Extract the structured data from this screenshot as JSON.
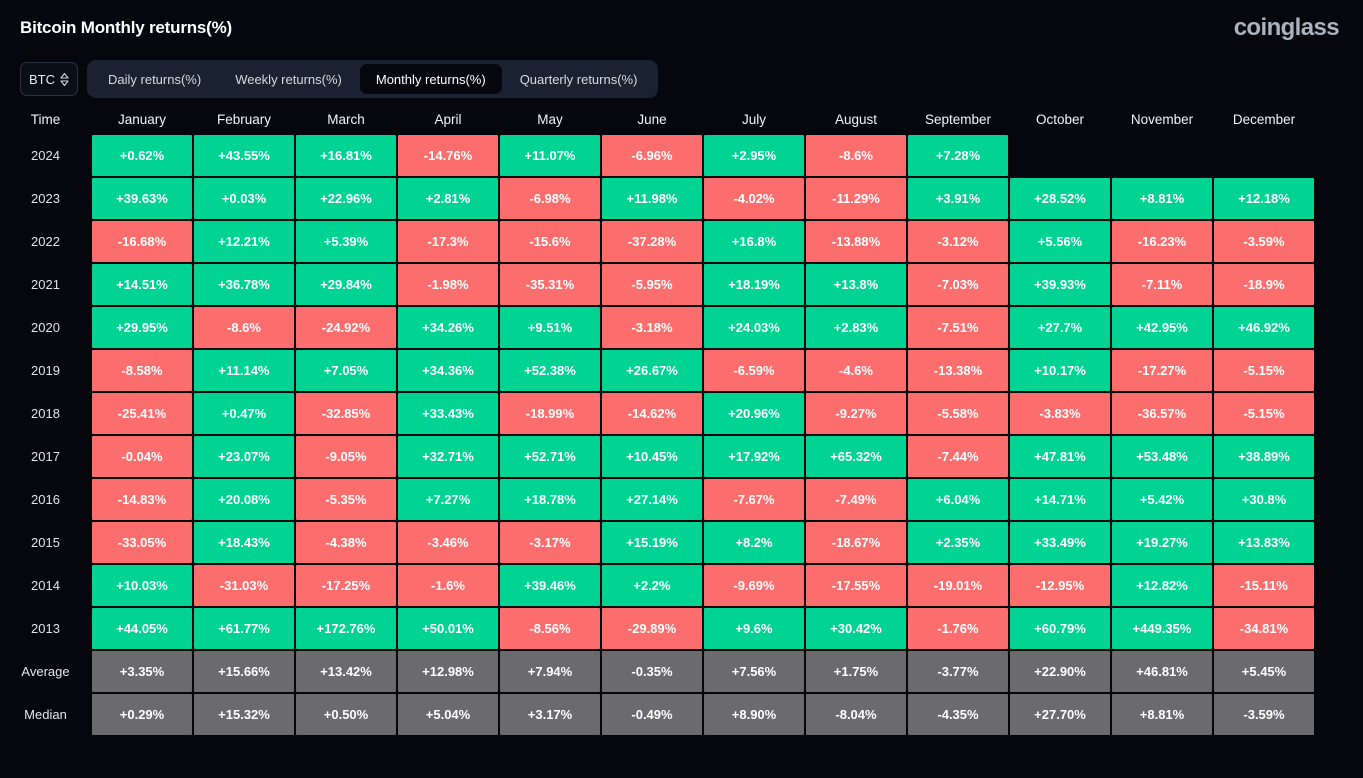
{
  "header": {
    "title": "Bitcoin Monthly returns(%)",
    "brand": "coinglass"
  },
  "toolbar": {
    "coin_selected": "BTC",
    "coin_icon": "chevron-up-down-icon",
    "tabs": [
      {
        "label": "Daily returns(%)",
        "active": false
      },
      {
        "label": "Weekly returns(%)",
        "active": false
      },
      {
        "label": "Monthly returns(%)",
        "active": true
      },
      {
        "label": "Quarterly returns(%)",
        "active": false
      }
    ]
  },
  "colors": {
    "positive": "#00d392",
    "negative": "#fc6e6e",
    "neutral": "#6b6b6e",
    "background": "#05070d",
    "tab_bar": "#1a2130",
    "brand_text": "#aab2bd"
  },
  "chart_data": {
    "type": "heatmap",
    "title": "Bitcoin Monthly returns(%)",
    "xlabel": "",
    "ylabel": "Time",
    "columns": [
      "Time",
      "January",
      "February",
      "March",
      "April",
      "May",
      "June",
      "July",
      "August",
      "September",
      "October",
      "November",
      "December"
    ],
    "rows": [
      {
        "label": "2024",
        "kind": "year",
        "values": [
          "+0.62%",
          "+43.55%",
          "+16.81%",
          "-14.76%",
          "+11.07%",
          "-6.96%",
          "+2.95%",
          "-8.6%",
          "+7.28%",
          "",
          "",
          ""
        ]
      },
      {
        "label": "2023",
        "kind": "year",
        "values": [
          "+39.63%",
          "+0.03%",
          "+22.96%",
          "+2.81%",
          "-6.98%",
          "+11.98%",
          "-4.02%",
          "-11.29%",
          "+3.91%",
          "+28.52%",
          "+8.81%",
          "+12.18%"
        ]
      },
      {
        "label": "2022",
        "kind": "year",
        "values": [
          "-16.68%",
          "+12.21%",
          "+5.39%",
          "-17.3%",
          "-15.6%",
          "-37.28%",
          "+16.8%",
          "-13.88%",
          "-3.12%",
          "+5.56%",
          "-16.23%",
          "-3.59%"
        ]
      },
      {
        "label": "2021",
        "kind": "year",
        "values": [
          "+14.51%",
          "+36.78%",
          "+29.84%",
          "-1.98%",
          "-35.31%",
          "-5.95%",
          "+18.19%",
          "+13.8%",
          "-7.03%",
          "+39.93%",
          "-7.11%",
          "-18.9%"
        ]
      },
      {
        "label": "2020",
        "kind": "year",
        "values": [
          "+29.95%",
          "-8.6%",
          "-24.92%",
          "+34.26%",
          "+9.51%",
          "-3.18%",
          "+24.03%",
          "+2.83%",
          "-7.51%",
          "+27.7%",
          "+42.95%",
          "+46.92%"
        ]
      },
      {
        "label": "2019",
        "kind": "year",
        "values": [
          "-8.58%",
          "+11.14%",
          "+7.05%",
          "+34.36%",
          "+52.38%",
          "+26.67%",
          "-6.59%",
          "-4.6%",
          "-13.38%",
          "+10.17%",
          "-17.27%",
          "-5.15%"
        ]
      },
      {
        "label": "2018",
        "kind": "year",
        "values": [
          "-25.41%",
          "+0.47%",
          "-32.85%",
          "+33.43%",
          "-18.99%",
          "-14.62%",
          "+20.96%",
          "-9.27%",
          "-5.58%",
          "-3.83%",
          "-36.57%",
          "-5.15%"
        ]
      },
      {
        "label": "2017",
        "kind": "year",
        "values": [
          "-0.04%",
          "+23.07%",
          "-9.05%",
          "+32.71%",
          "+52.71%",
          "+10.45%",
          "+17.92%",
          "+65.32%",
          "-7.44%",
          "+47.81%",
          "+53.48%",
          "+38.89%"
        ]
      },
      {
        "label": "2016",
        "kind": "year",
        "values": [
          "-14.83%",
          "+20.08%",
          "-5.35%",
          "+7.27%",
          "+18.78%",
          "+27.14%",
          "-7.67%",
          "-7.49%",
          "+6.04%",
          "+14.71%",
          "+5.42%",
          "+30.8%"
        ]
      },
      {
        "label": "2015",
        "kind": "year",
        "values": [
          "-33.05%",
          "+18.43%",
          "-4.38%",
          "-3.46%",
          "-3.17%",
          "+15.19%",
          "+8.2%",
          "-18.67%",
          "+2.35%",
          "+33.49%",
          "+19.27%",
          "+13.83%"
        ]
      },
      {
        "label": "2014",
        "kind": "year",
        "values": [
          "+10.03%",
          "-31.03%",
          "-17.25%",
          "-1.6%",
          "+39.46%",
          "+2.2%",
          "-9.69%",
          "-17.55%",
          "-19.01%",
          "-12.95%",
          "+12.82%",
          "-15.11%"
        ]
      },
      {
        "label": "2013",
        "kind": "year",
        "values": [
          "+44.05%",
          "+61.77%",
          "+172.76%",
          "+50.01%",
          "-8.56%",
          "-29.89%",
          "+9.6%",
          "+30.42%",
          "-1.76%",
          "+60.79%",
          "+449.35%",
          "-34.81%"
        ]
      },
      {
        "label": "Average",
        "kind": "stat",
        "values": [
          "+3.35%",
          "+15.66%",
          "+13.42%",
          "+12.98%",
          "+7.94%",
          "-0.35%",
          "+7.56%",
          "+1.75%",
          "-3.77%",
          "+22.90%",
          "+46.81%",
          "+5.45%"
        ]
      },
      {
        "label": "Median",
        "kind": "stat",
        "values": [
          "+0.29%",
          "+15.32%",
          "+0.50%",
          "+5.04%",
          "+3.17%",
          "-0.49%",
          "+8.90%",
          "-8.04%",
          "-4.35%",
          "+27.70%",
          "+8.81%",
          "-3.59%"
        ]
      }
    ]
  }
}
